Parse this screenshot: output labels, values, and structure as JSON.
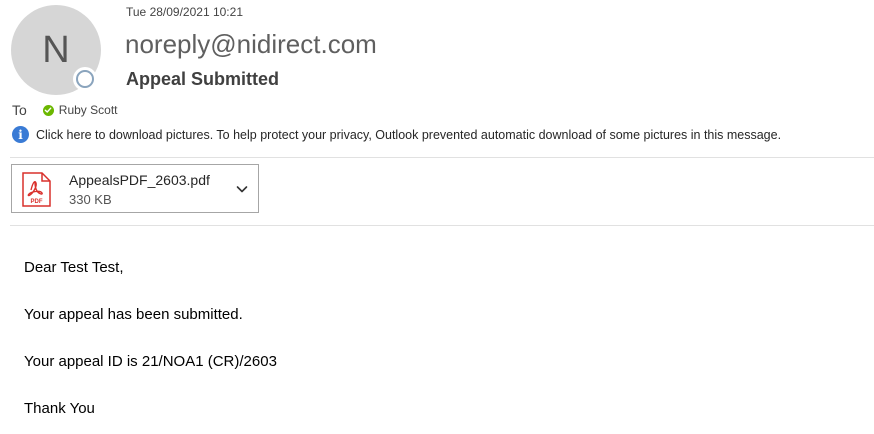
{
  "header": {
    "avatar_initial": "N",
    "timestamp": "Tue 28/09/2021 10:21",
    "sender": "noreply@nidirect.com",
    "subject": "Appeal Submitted",
    "to_label": "To",
    "recipient": "Ruby Scott",
    "info_bar": "Click here to download pictures. To help protect your privacy, Outlook prevented automatic download of some pictures in this message."
  },
  "attachment": {
    "filename": "AppealsPDF_2603.pdf",
    "size": "330 KB",
    "icon_label": "PDF"
  },
  "body": {
    "greeting": "Dear Test Test,",
    "line1": "Your appeal has been submitted.",
    "line2": "Your appeal ID is 21/NOA1 (CR)/2603",
    "signoff": "Thank You"
  },
  "colors": {
    "avatar_bg": "#d6d6d6",
    "presence_ring": "#8aa4bd",
    "recipient_status": "#6bb700",
    "info_icon": "#3a7bd5",
    "pdf_red": "#d9302c"
  },
  "icons": {
    "presence": "presence-unknown-icon",
    "recipient_status": "checkmark-status-icon",
    "info": "info-icon",
    "attachment": "pdf-file-icon",
    "dropdown": "chevron-down-icon"
  }
}
